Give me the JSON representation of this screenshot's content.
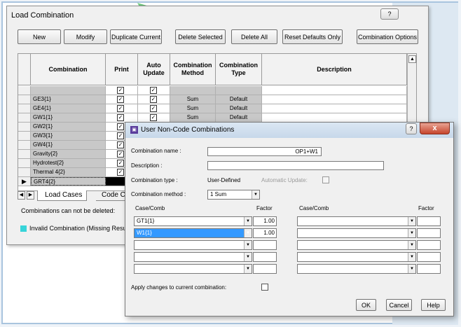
{
  "main_window": {
    "title": "Load Combination",
    "help_label": "?",
    "toolbar": [
      {
        "label": "New"
      },
      {
        "label": "Modify"
      },
      {
        "label": "Duplicate Current"
      },
      {
        "label": "Delete Selected"
      },
      {
        "label": "Delete All"
      },
      {
        "label": "Reset Defaults Only"
      },
      {
        "label": "Combination Options"
      }
    ],
    "table": {
      "columns": [
        "",
        "Combination",
        "Print",
        "Auto Update",
        "Combination Method",
        "Combination Type",
        "Description"
      ],
      "rows": [
        {
          "name": "",
          "print": true,
          "auto": true,
          "method": "",
          "type": ""
        },
        {
          "name": "GE3{1}",
          "print": true,
          "auto": true,
          "method": "Sum",
          "type": "Default"
        },
        {
          "name": "GE4{1}",
          "print": true,
          "auto": true,
          "method": "Sum",
          "type": "Default"
        },
        {
          "name": "GW1{1}",
          "print": true,
          "auto": true,
          "method": "Sum",
          "type": "Default"
        },
        {
          "name": "GW2{1}",
          "print": true,
          "auto": true,
          "method": "Sum",
          "type": "Default"
        },
        {
          "name": "GW3{1}",
          "print": true,
          "auto": true,
          "method": "",
          "type": ""
        },
        {
          "name": "GW4{1}",
          "print": true,
          "auto": true,
          "method": "",
          "type": ""
        },
        {
          "name": "Gravity{2}",
          "print": true,
          "auto": true,
          "method": "",
          "type": ""
        },
        {
          "name": "Hydrotest{2}",
          "print": true,
          "auto": true,
          "method": "",
          "type": ""
        },
        {
          "name": "Thermal 4{2}",
          "print": true,
          "auto": true,
          "method": "",
          "type": ""
        },
        {
          "name": "GRT4{2}",
          "print": true,
          "auto": true,
          "method": "",
          "type": ""
        }
      ]
    },
    "tabs": [
      "Load Cases",
      "Code Com"
    ],
    "status_text": "Combinations can not be deleted:",
    "legend_text": "Invalid Combination (Missing Result"
  },
  "dialog": {
    "title": "User Non-Code Combinations",
    "help_label": "?",
    "close_label": "x",
    "combination_name_label": "Combination name :",
    "combination_name_value": "OP1+W1",
    "description_label": "Description :",
    "description_value": "",
    "combination_type_label": "Combination type :",
    "combination_type_value": "User-Defined",
    "automatic_update_label": "Automatic Update:",
    "combination_method_label": "Combination method :",
    "combination_method_value": "1 Sum",
    "case_comb_header": "Case/Comb",
    "factor_header": "Factor",
    "left_rows": [
      {
        "case": "GT1{1}",
        "factor": "1.00"
      },
      {
        "case": "W1{1}",
        "factor": "1.00"
      },
      {
        "case": "",
        "factor": ""
      },
      {
        "case": "",
        "factor": ""
      },
      {
        "case": "",
        "factor": ""
      }
    ],
    "right_rows": [
      {
        "case": "",
        "factor": ""
      },
      {
        "case": "",
        "factor": ""
      },
      {
        "case": "",
        "factor": ""
      },
      {
        "case": "",
        "factor": ""
      },
      {
        "case": "",
        "factor": ""
      }
    ],
    "apply_label": "Apply changes to current combination:",
    "buttons": {
      "ok": "OK",
      "cancel": "Cancel",
      "help": "Help"
    }
  },
  "colors": {
    "legend_invalid": "#37d4d9",
    "selection": "#3399ff",
    "close_button": "#c6452c"
  }
}
